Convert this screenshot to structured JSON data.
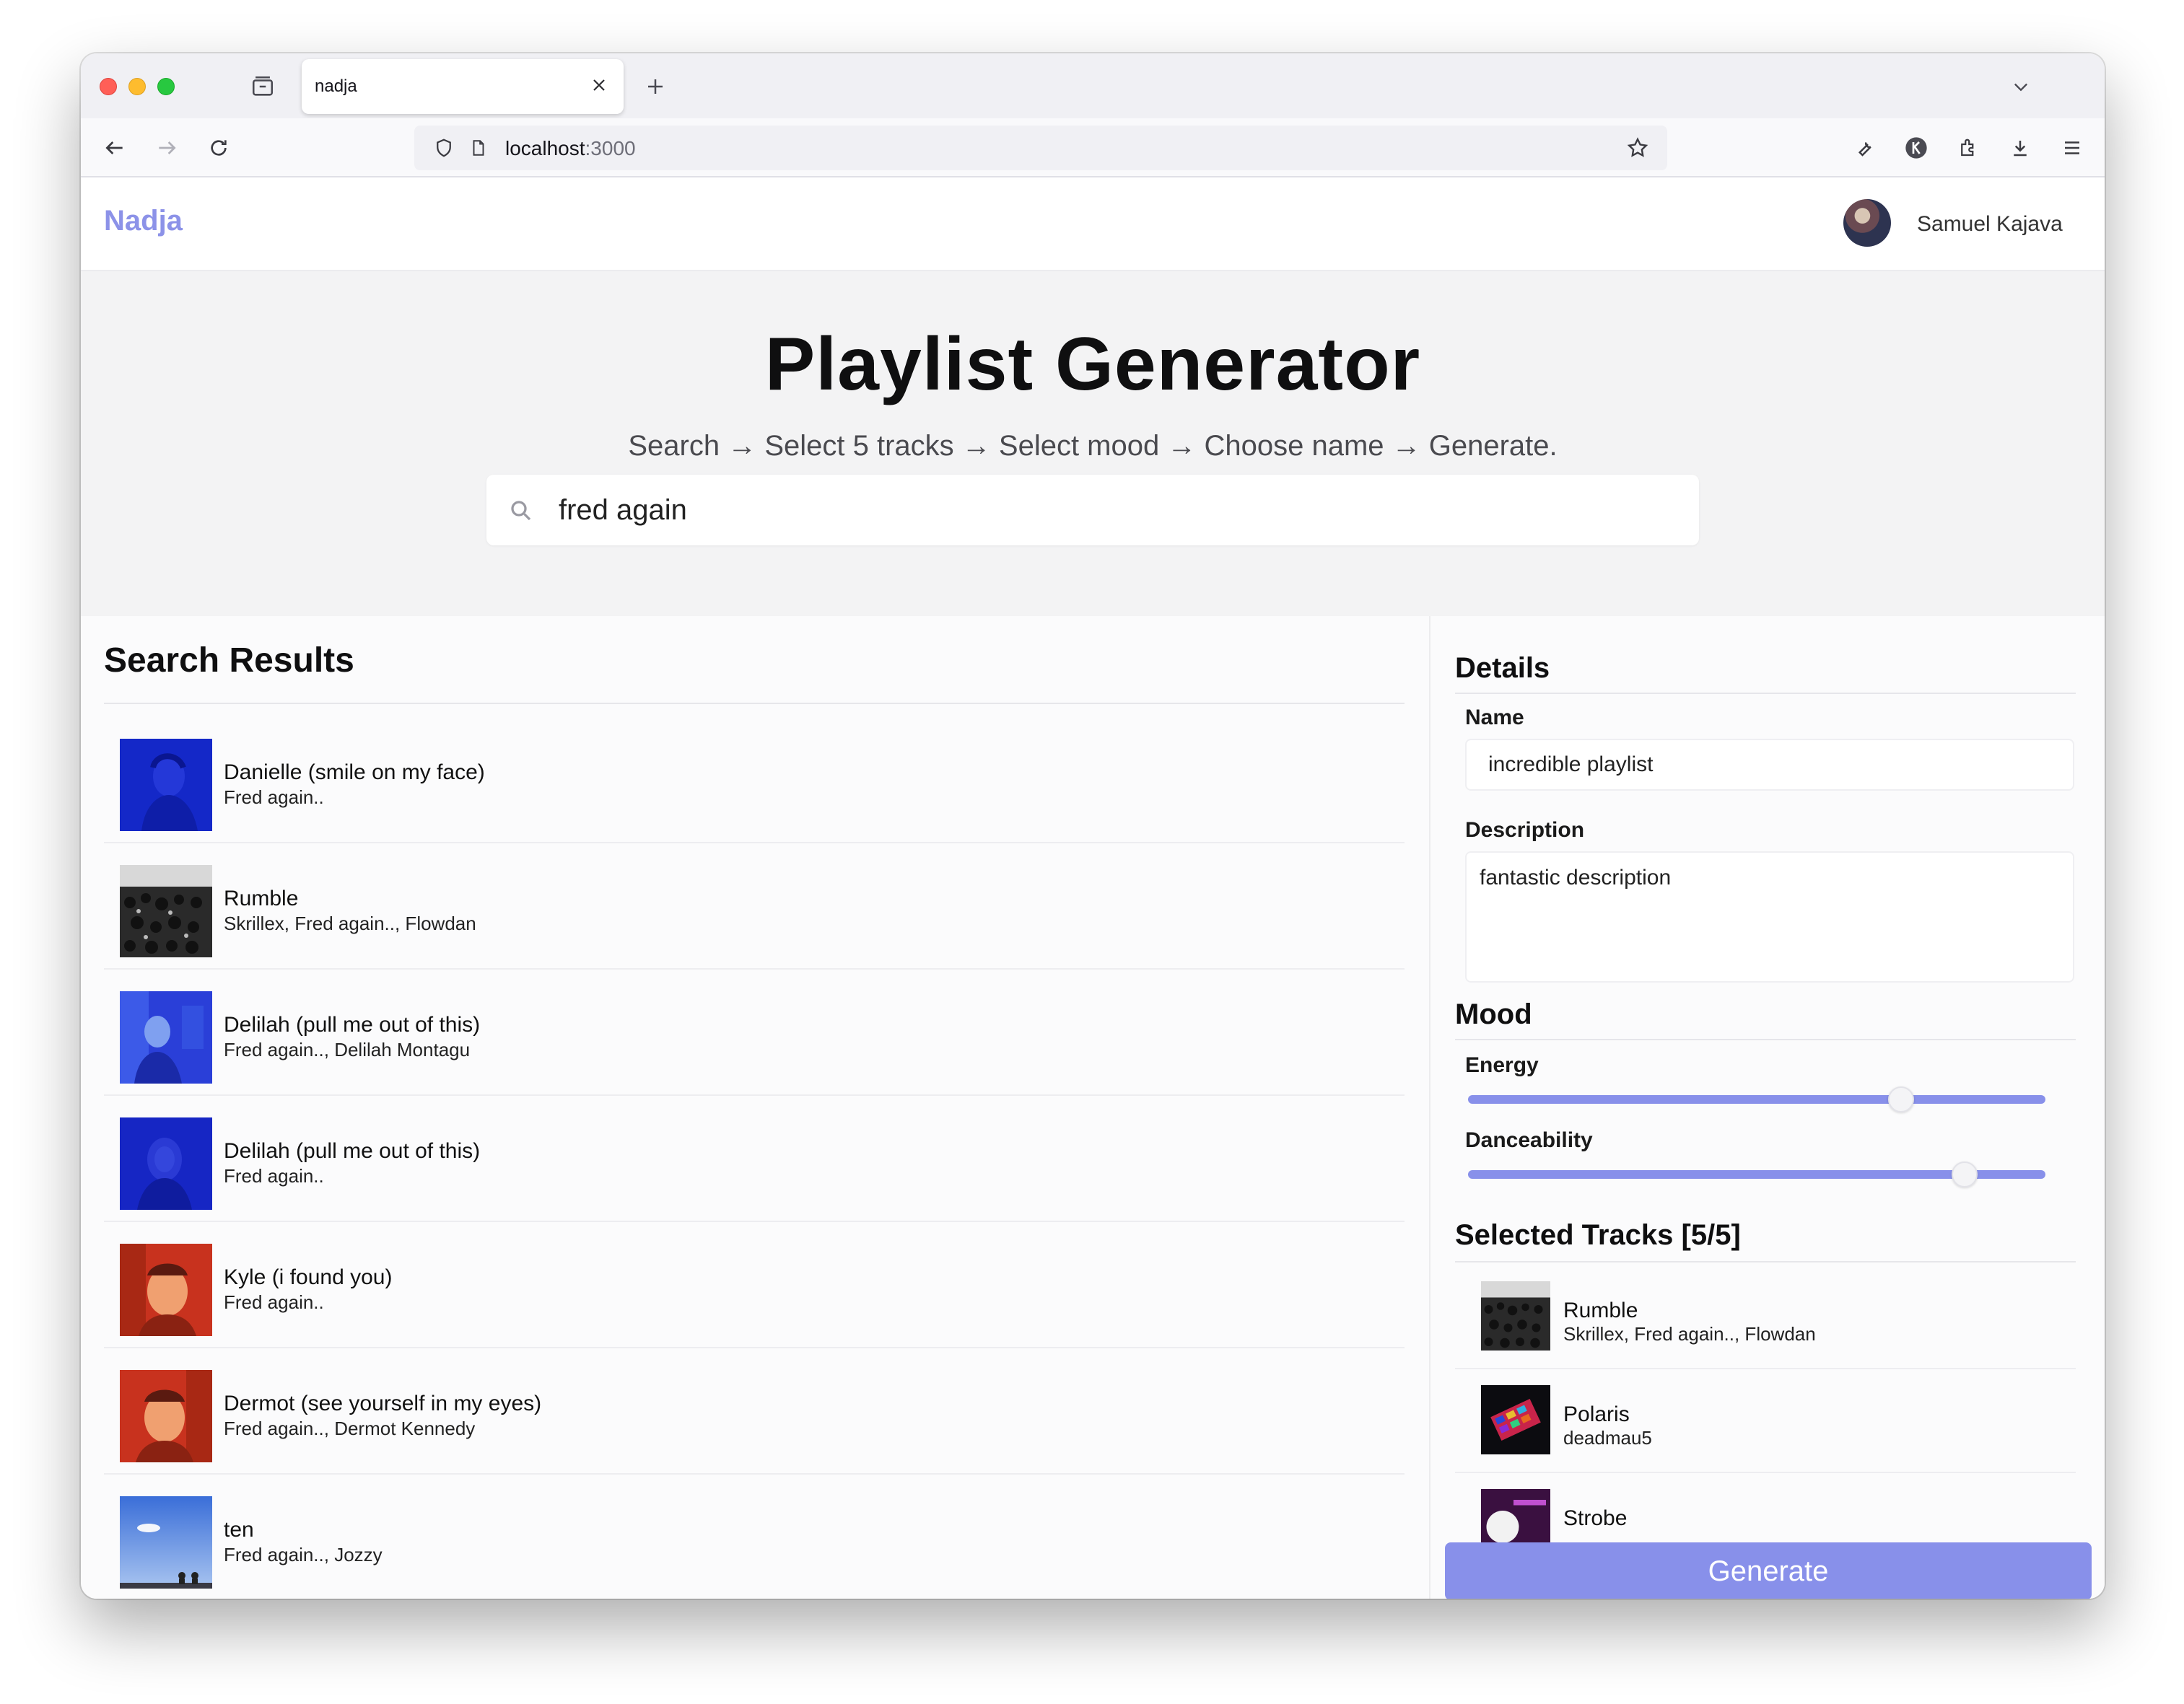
{
  "browser": {
    "tab_title": "nadja",
    "url_host": "localhost",
    "url_port": ":3000"
  },
  "app": {
    "brand": "Nadja",
    "user_name": "Samuel Kajava"
  },
  "hero": {
    "title": "Playlist Generator",
    "subtitle": "Search → Select 5 tracks → Select mood → Choose name → Generate.",
    "search_value": "fred again"
  },
  "results": {
    "title": "Search Results",
    "tracks": [
      {
        "name": "Danielle (smile on my face)",
        "artist": "Fred again.."
      },
      {
        "name": "Rumble",
        "artist": "Skrillex, Fred again.., Flowdan"
      },
      {
        "name": "Delilah (pull me out of this)",
        "artist": "Fred again.., Delilah Montagu"
      },
      {
        "name": "Delilah (pull me out of this)",
        "artist": "Fred again.."
      },
      {
        "name": "Kyle (i found you)",
        "artist": "Fred again.."
      },
      {
        "name": "Dermot (see yourself in my eyes)",
        "artist": "Fred again.., Dermot Kennedy"
      },
      {
        "name": "ten",
        "artist": "Fred again.., Jozzy"
      }
    ]
  },
  "details": {
    "title": "Details",
    "name_label": "Name",
    "name_value": "incredible playlist",
    "description_label": "Description",
    "description_value": "fantastic description"
  },
  "mood": {
    "title": "Mood",
    "energy_label": "Energy",
    "energy_value": 0.75,
    "danceability_label": "Danceability",
    "danceability_value": 0.86
  },
  "selected": {
    "title": "Selected Tracks [5/5]",
    "tracks": [
      {
        "name": "Rumble",
        "artist": "Skrillex, Fred again.., Flowdan"
      },
      {
        "name": "Polaris",
        "artist": "deadmau5"
      },
      {
        "name": "Strobe",
        "artist": ""
      }
    ]
  },
  "actions": {
    "generate_label": "Generate"
  },
  "colors": {
    "accent": "#8890ea",
    "brand": "#8c92e8"
  }
}
